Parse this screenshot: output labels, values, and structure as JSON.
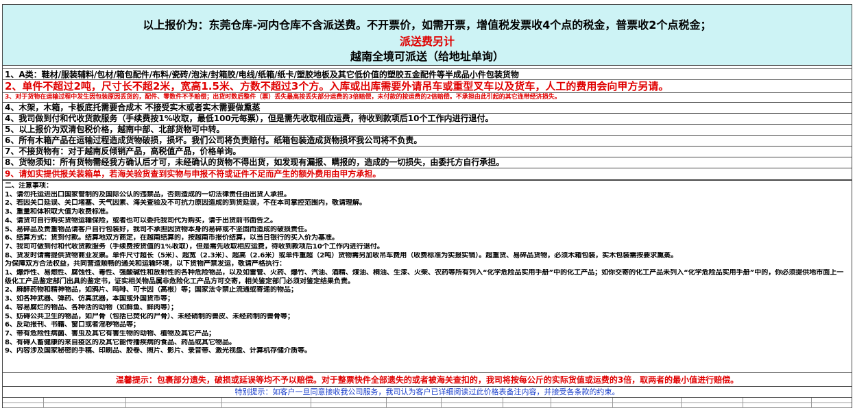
{
  "header": {
    "line1": "以上报价为：东莞仓库-河内仓库不含派送费。不开票价，如需开票，增值税发票收4个点的税金，普票收2个点税金；",
    "line2": "派送费另计",
    "line3": "越南全境可派送（给地址单询）"
  },
  "rows": [
    {
      "text": "1、A类：鞋材/服装辅料/包材/箱包配件/布料/瓷砖/泡沫/封箱胶/电线/纸箱/纸卡/塑胶地板及其它低价值的塑胶五金配件等半成品小件包装货物",
      "color": "#000000"
    },
    {
      "text": "2、单件不超过2吨，尺寸长不超2米，宽高1.5米、方数不超过3个方。入库或出库需要外请吊车或重型叉车以及货车，人工的费用会向甲方另请。",
      "color": "#e00000"
    },
    {
      "text": "3、对于货物在运输过程中发生因包装原因丢货的，配件、零数件不予赔偿；出货时数后整件（票）丢失最高按丢失部分运费的3倍赔偿，未付款的按运费的2倍赔偿。不承担由此引起的其它连带经济损失。",
      "color": "#e00000"
    },
    {
      "text": "4、木架，木箱，卡板底托需要合成木  不接受实木或者实木需要做熏蒸",
      "color": "#000000"
    },
    {
      "text": "4、我司做到付和代收货款服务（手续费按1%收取，最低100元每票），但是需先收取相应运费，待收到款项后10个工作内进行退付。",
      "color": "#000000"
    },
    {
      "text": "5、以上报价为双清包税价格，越南中部、北部货物可中转。",
      "color": "#000000"
    },
    {
      "text": "6、所有木箱产品在运输过程造成货物破损，损坏。我们公司将负责赔付。纸箱包装造成货物损坏我公司将不负责。",
      "color": "#000000"
    },
    {
      "text": "7、不接货物有：对于越南反倾销产品，高税值产品，价格单询。",
      "color": "#000000"
    },
    {
      "text": "8、货物须知：所有货物需经我方确认后才可，未经确认的货物不得出货，如发现有漏报、瞒报的，造成的一切损失，由委托方自行承担。",
      "color": "#000000"
    },
    {
      "text": "9、请如实提供报关装箱单，若海关验货查到实物与申报不符或证件不足而产生的额外费用由甲方承担。",
      "color": "#e00000"
    }
  ],
  "notes": [
    "二、注意事项：",
    "1、请勿托运进出口国家管制的及国际公认的违禁品，否则造成的一切法律责任由出货人承担。",
    "2、若因关口延误、关口堵塞、天气因素、海关查验及不可抗力原因造成的到货延误，不在本司掌控范围内，敬请理解。",
    "3、重量和体积取大值为收费标准。",
    "4、请货可自行购买货物运输保险，或者也可以委托我司代为购买，请于出货前书面告之。",
    "5、易碎品及贵重物品请客户自行包装好，我司不承担因货物本身的易碎或不坚固而造成的破损责任。",
    "6、结算方式：货到付款。结算地双方商定，在越南结算的，按越南币报价结算，以当日银行的买入价为基准。",
    "7、我司可做到付和代收货款服务（手续费按货值的1%收取），但是需先收取相应运费，待收到款项后10个工作内进行退付。",
    "8、货发时请需提供货物商业发票。单件尺寸超长（5米）、超宽（2.3米）、超高（2.6米）或单件重超（2吨）货物需另加收吊车费用（收费标准为实报实销）。超重货、易碎品货物，必须木箱包装，实木包装需按要求熏蒸。",
    "为保障双方合法权益，共同营造顺畅的通关和运输环境，以下货物严禁发运，敬请严格执行：",
    "1、爆炸性、易燃性、腐蚀性、毒性、强酸碱性和放射性的各种危险物品，以及如雷管、火药、爆竹、汽油、酒精、煤油、桐油、生漆、火柴、农药等所有列入“化学危险品实用手册”中的化工产品；如你交寄的化工产品未列入“化学危险品实用手册”中的，你必须提供地市面上一级化工产品鉴定部门出具的鉴定书，证实相关物品属非危险化工产品方可交寄，相关鉴定部门必须对鉴定结果负责。",
    "2、麻醉药物和精神物品，如鸦片、吗啡、可卡因（高根）等；国家法令禁止流通或寄递的物品；",
    "3、如各种武器、弹药、仿真武器，本国或外国货币等；",
    "4、容易腐烂的物品、各种活的动物（如鲜鱼、鲜肉等）；",
    "5、妨碍公共卫生的物品，如尸骨（包括已焚化的尸骨）、未经硝制的兽皮、未经药制的兽骨等；",
    "6、反动报刊、书籍、窗口或者淫秽物品等；",
    "7、带有危险性病菌、害虫及其它有害生物的动物、植物及其它产品；",
    "8、有碍人畜健康的来自疫区的及其它能传播疾病的食品、药品或其它物品。",
    "9、内容涉及国家秘密的手稿、印刷品、胶卷、照片、影片、录音带、激光视盘、计算机存储介质等。"
  ],
  "warm_tip": "温馨提示：包裹部分遗失，破损或延误等均不予以赔偿。对于整票快件全部遗失的或者被海关查扣的，我司将按每公斤的实际货值或运费的3倍，取两者的最小值进行赔偿。",
  "special_tip": "特别提示：如客户一旦同意接收我公司服务，我司认为客户已详细阅读过此价格表备注内容，并接受各条款的约束。",
  "colors": {
    "header_bg": "#cdf3f5",
    "red": "#e00000",
    "blue": "#1a3fcc"
  }
}
